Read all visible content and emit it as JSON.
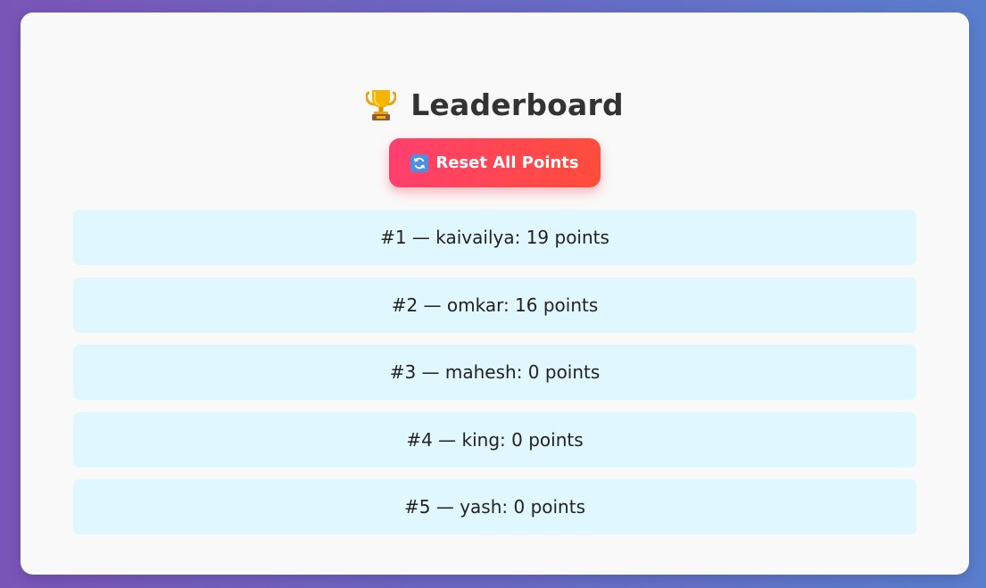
{
  "header": {
    "title": "Leaderboard",
    "icon": "trophy-icon"
  },
  "reset_button": {
    "label": "Reset All Points",
    "icon": "refresh-icon"
  },
  "colors": {
    "background_start": "#7a55b8",
    "background_end": "#5a7ecd",
    "card": "#f9f9f9",
    "row": "#e0f7fe",
    "button_start": "#ff3f6e",
    "button_end": "#ff4d3b",
    "title": "#333333"
  },
  "leaderboard": [
    {
      "text": "#1 — kaivailya: 19 points"
    },
    {
      "text": "#2 — omkar: 16 points"
    },
    {
      "text": "#3 — mahesh: 0 points"
    },
    {
      "text": "#4 — king: 0 points"
    },
    {
      "text": "#5 — yash: 0 points"
    }
  ]
}
